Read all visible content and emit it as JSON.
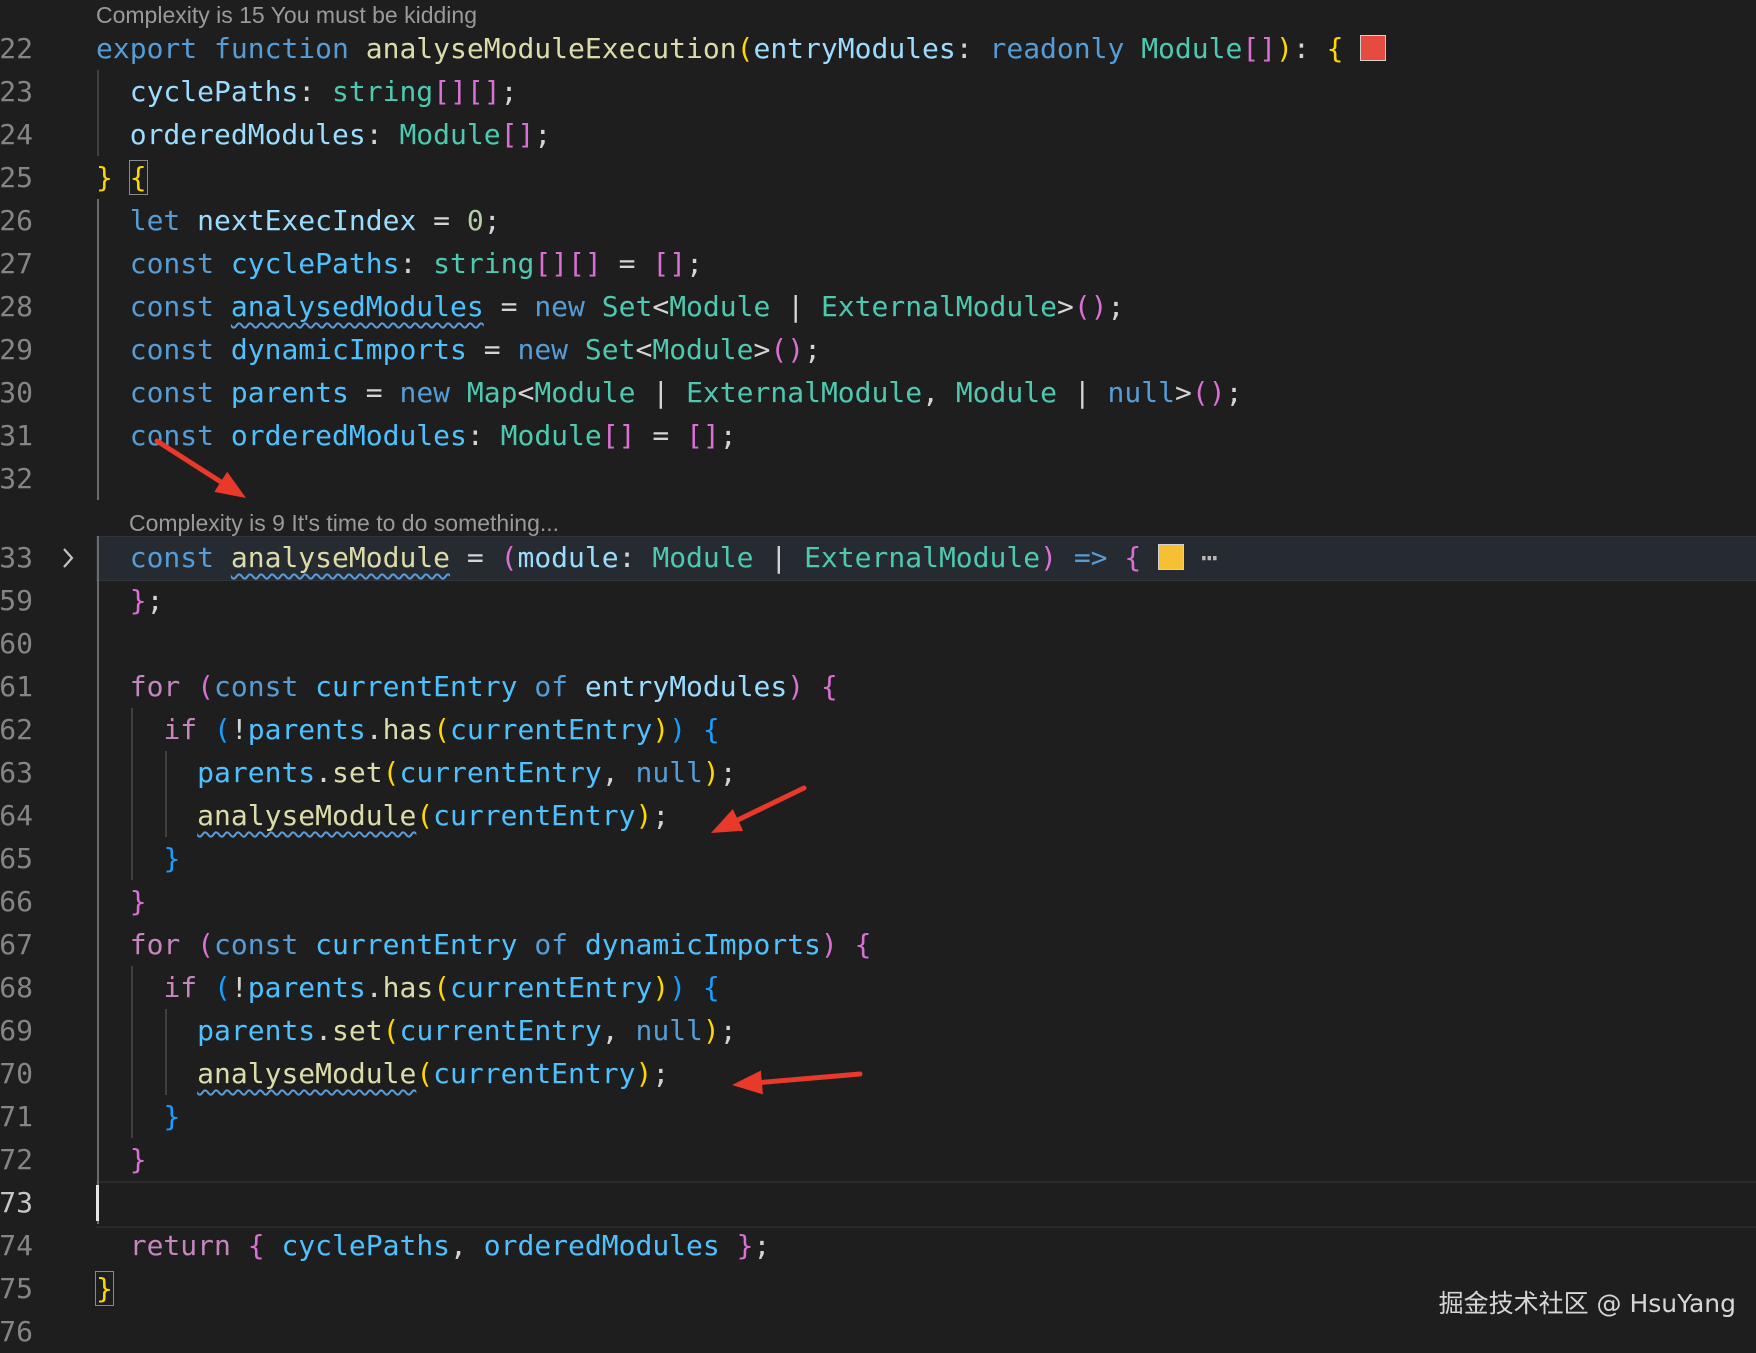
{
  "editor": {
    "codelens": [
      {
        "text": "Complexity is 15 You must be kidding"
      },
      {
        "text": "Complexity is 9 It's time to do something..."
      }
    ],
    "lines": [
      {
        "num": "22",
        "tokens": [
          [
            "export",
            "kw"
          ],
          [
            " ",
            "pn"
          ],
          [
            "function",
            "kw"
          ],
          [
            " ",
            "pn"
          ],
          [
            "analyseModuleExecution",
            "fn"
          ],
          [
            "(",
            "b1"
          ],
          [
            "entryModules",
            "vr"
          ],
          [
            ":",
            "pn"
          ],
          [
            " ",
            "pn"
          ],
          [
            "readonly",
            "kw"
          ],
          [
            " ",
            "pn"
          ],
          [
            "Module",
            "ty"
          ],
          [
            "[]",
            "b2"
          ],
          [
            ")",
            "b1"
          ],
          [
            ":",
            "pn"
          ],
          [
            " ",
            "pn"
          ],
          [
            "{",
            "b1"
          ],
          [
            " ",
            "pn"
          ],
          [
            "",
            "swatch-red"
          ]
        ]
      },
      {
        "num": "23",
        "tokens": [
          [
            "  ",
            "pn"
          ],
          [
            "cyclePaths",
            "vr"
          ],
          [
            ":",
            "pn"
          ],
          [
            " ",
            "pn"
          ],
          [
            "string",
            "ty"
          ],
          [
            "[]",
            "b2"
          ],
          [
            "[]",
            "b2"
          ],
          [
            ";",
            "pn"
          ]
        ]
      },
      {
        "num": "24",
        "tokens": [
          [
            "  ",
            "pn"
          ],
          [
            "orderedModules",
            "vr"
          ],
          [
            ":",
            "pn"
          ],
          [
            " ",
            "pn"
          ],
          [
            "Module",
            "ty"
          ],
          [
            "[]",
            "b2"
          ],
          [
            ";",
            "pn"
          ]
        ]
      },
      {
        "num": "25",
        "tokens": [
          [
            "}",
            "b1"
          ],
          [
            " ",
            "pn"
          ],
          [
            "{",
            "b1 bm"
          ]
        ]
      },
      {
        "num": "26",
        "tokens": [
          [
            "  ",
            "pn"
          ],
          [
            "let",
            "kw"
          ],
          [
            " ",
            "pn"
          ],
          [
            "nextExecIndex",
            "vr"
          ],
          [
            " = ",
            "pn"
          ],
          [
            "0",
            "nm"
          ],
          [
            ";",
            "pn"
          ]
        ]
      },
      {
        "num": "27",
        "tokens": [
          [
            "  ",
            "pn"
          ],
          [
            "const",
            "kw"
          ],
          [
            " ",
            "pn"
          ],
          [
            "cyclePaths",
            "cn"
          ],
          [
            ":",
            "pn"
          ],
          [
            " ",
            "pn"
          ],
          [
            "string",
            "ty"
          ],
          [
            "[]",
            "b2"
          ],
          [
            "[]",
            "b2"
          ],
          [
            " = ",
            "pn"
          ],
          [
            "[]",
            "b2"
          ],
          [
            ";",
            "pn"
          ]
        ]
      },
      {
        "num": "28",
        "tokens": [
          [
            "  ",
            "pn"
          ],
          [
            "const",
            "kw"
          ],
          [
            " ",
            "pn"
          ],
          [
            "analysedModules",
            "cn sq"
          ],
          [
            " = ",
            "pn"
          ],
          [
            "new",
            "kw"
          ],
          [
            " ",
            "pn"
          ],
          [
            "Set",
            "ty"
          ],
          [
            "<",
            "pn"
          ],
          [
            "Module",
            "ty"
          ],
          [
            " | ",
            "pn"
          ],
          [
            "ExternalModule",
            "ty"
          ],
          [
            ">",
            "pn"
          ],
          [
            "()",
            "b2"
          ],
          [
            ";",
            "pn"
          ]
        ]
      },
      {
        "num": "29",
        "tokens": [
          [
            "  ",
            "pn"
          ],
          [
            "const",
            "kw"
          ],
          [
            " ",
            "pn"
          ],
          [
            "dynamicImports",
            "cn"
          ],
          [
            " = ",
            "pn"
          ],
          [
            "new",
            "kw"
          ],
          [
            " ",
            "pn"
          ],
          [
            "Set",
            "ty"
          ],
          [
            "<",
            "pn"
          ],
          [
            "Module",
            "ty"
          ],
          [
            ">",
            "pn"
          ],
          [
            "()",
            "b2"
          ],
          [
            ";",
            "pn"
          ]
        ]
      },
      {
        "num": "30",
        "tokens": [
          [
            "  ",
            "pn"
          ],
          [
            "const",
            "kw"
          ],
          [
            " ",
            "pn"
          ],
          [
            "parents",
            "cn"
          ],
          [
            " = ",
            "pn"
          ],
          [
            "new",
            "kw"
          ],
          [
            " ",
            "pn"
          ],
          [
            "Map",
            "ty"
          ],
          [
            "<",
            "pn"
          ],
          [
            "Module",
            "ty"
          ],
          [
            " | ",
            "pn"
          ],
          [
            "ExternalModule",
            "ty"
          ],
          [
            ", ",
            "pn"
          ],
          [
            "Module",
            "ty"
          ],
          [
            " | ",
            "pn"
          ],
          [
            "null",
            "kw"
          ],
          [
            ">",
            "pn"
          ],
          [
            "()",
            "b2"
          ],
          [
            ";",
            "pn"
          ]
        ]
      },
      {
        "num": "31",
        "tokens": [
          [
            "  ",
            "pn"
          ],
          [
            "const",
            "kw"
          ],
          [
            " ",
            "pn"
          ],
          [
            "orderedModules",
            "cn"
          ],
          [
            ":",
            "pn"
          ],
          [
            " ",
            "pn"
          ],
          [
            "Module",
            "ty"
          ],
          [
            "[]",
            "b2"
          ],
          [
            " = ",
            "pn"
          ],
          [
            "[]",
            "b2"
          ],
          [
            ";",
            "pn"
          ]
        ]
      },
      {
        "num": "32",
        "tokens": []
      },
      {
        "num": "33",
        "tokens": [
          [
            "  ",
            "pn"
          ],
          [
            "const",
            "kw"
          ],
          [
            " ",
            "pn"
          ],
          [
            "analyseModule",
            "fn sq"
          ],
          [
            " = ",
            "pn"
          ],
          [
            "(",
            "b2"
          ],
          [
            "module",
            "vr"
          ],
          [
            ":",
            "pn"
          ],
          [
            " ",
            "pn"
          ],
          [
            "Module",
            "ty"
          ],
          [
            " | ",
            "pn"
          ],
          [
            "ExternalModule",
            "ty"
          ],
          [
            ")",
            "b2"
          ],
          [
            " ",
            "pn"
          ],
          [
            "=>",
            "kw"
          ],
          [
            " ",
            "pn"
          ],
          [
            "{",
            "b2"
          ],
          [
            " ",
            "pn"
          ],
          [
            "",
            "swatch-yellow"
          ],
          [
            " ",
            "pn"
          ],
          [
            "⋯",
            "ellipsis"
          ]
        ]
      },
      {
        "num": "59",
        "tokens": [
          [
            "  ",
            "pn"
          ],
          [
            "}",
            "b2"
          ],
          [
            ";",
            "pn"
          ]
        ]
      },
      {
        "num": "60",
        "tokens": []
      },
      {
        "num": "61",
        "tokens": [
          [
            "  ",
            "pn"
          ],
          [
            "for",
            "kw2"
          ],
          [
            " ",
            "pn"
          ],
          [
            "(",
            "b2"
          ],
          [
            "const",
            "kw"
          ],
          [
            " ",
            "pn"
          ],
          [
            "currentEntry",
            "cn"
          ],
          [
            " ",
            "pn"
          ],
          [
            "of",
            "kw"
          ],
          [
            " ",
            "pn"
          ],
          [
            "entryModules",
            "vr"
          ],
          [
            ")",
            "b2"
          ],
          [
            " ",
            "pn"
          ],
          [
            "{",
            "b2"
          ]
        ]
      },
      {
        "num": "62",
        "tokens": [
          [
            "    ",
            "pn"
          ],
          [
            "if",
            "kw2"
          ],
          [
            " ",
            "pn"
          ],
          [
            "(",
            "b3"
          ],
          [
            "!",
            "pn"
          ],
          [
            "parents",
            "cn"
          ],
          [
            ".",
            "pn"
          ],
          [
            "has",
            "fn"
          ],
          [
            "(",
            "b1"
          ],
          [
            "currentEntry",
            "cn"
          ],
          [
            ")",
            "b1"
          ],
          [
            ")",
            "b3"
          ],
          [
            " ",
            "pn"
          ],
          [
            "{",
            "b3"
          ]
        ]
      },
      {
        "num": "63",
        "tokens": [
          [
            "      ",
            "pn"
          ],
          [
            "parents",
            "cn"
          ],
          [
            ".",
            "pn"
          ],
          [
            "set",
            "fn"
          ],
          [
            "(",
            "b1"
          ],
          [
            "currentEntry",
            "cn"
          ],
          [
            ", ",
            "pn"
          ],
          [
            "null",
            "kw"
          ],
          [
            ")",
            "b1"
          ],
          [
            ";",
            "pn"
          ]
        ]
      },
      {
        "num": "64",
        "tokens": [
          [
            "      ",
            "pn"
          ],
          [
            "analyseModule",
            "fn sq"
          ],
          [
            "(",
            "b1"
          ],
          [
            "currentEntry",
            "cn"
          ],
          [
            ")",
            "b1"
          ],
          [
            ";",
            "pn"
          ]
        ]
      },
      {
        "num": "65",
        "tokens": [
          [
            "    ",
            "pn"
          ],
          [
            "}",
            "b3"
          ]
        ]
      },
      {
        "num": "66",
        "tokens": [
          [
            "  ",
            "pn"
          ],
          [
            "}",
            "b2"
          ]
        ]
      },
      {
        "num": "67",
        "tokens": [
          [
            "  ",
            "pn"
          ],
          [
            "for",
            "kw2"
          ],
          [
            " ",
            "pn"
          ],
          [
            "(",
            "b2"
          ],
          [
            "const",
            "kw"
          ],
          [
            " ",
            "pn"
          ],
          [
            "currentEntry",
            "cn"
          ],
          [
            " ",
            "pn"
          ],
          [
            "of",
            "kw"
          ],
          [
            " ",
            "pn"
          ],
          [
            "dynamicImports",
            "cn"
          ],
          [
            ")",
            "b2"
          ],
          [
            " ",
            "pn"
          ],
          [
            "{",
            "b2"
          ]
        ]
      },
      {
        "num": "68",
        "tokens": [
          [
            "    ",
            "pn"
          ],
          [
            "if",
            "kw2"
          ],
          [
            " ",
            "pn"
          ],
          [
            "(",
            "b3"
          ],
          [
            "!",
            "pn"
          ],
          [
            "parents",
            "cn"
          ],
          [
            ".",
            "pn"
          ],
          [
            "has",
            "fn"
          ],
          [
            "(",
            "b1"
          ],
          [
            "currentEntry",
            "cn"
          ],
          [
            ")",
            "b1"
          ],
          [
            ")",
            "b3"
          ],
          [
            " ",
            "pn"
          ],
          [
            "{",
            "b3"
          ]
        ]
      },
      {
        "num": "69",
        "tokens": [
          [
            "      ",
            "pn"
          ],
          [
            "parents",
            "cn"
          ],
          [
            ".",
            "pn"
          ],
          [
            "set",
            "fn"
          ],
          [
            "(",
            "b1"
          ],
          [
            "currentEntry",
            "cn"
          ],
          [
            ", ",
            "pn"
          ],
          [
            "null",
            "kw"
          ],
          [
            ")",
            "b1"
          ],
          [
            ";",
            "pn"
          ]
        ]
      },
      {
        "num": "70",
        "tokens": [
          [
            "      ",
            "pn"
          ],
          [
            "analyseModule",
            "fn sq"
          ],
          [
            "(",
            "b1"
          ],
          [
            "currentEntry",
            "cn"
          ],
          [
            ")",
            "b1"
          ],
          [
            ";",
            "pn"
          ]
        ]
      },
      {
        "num": "71",
        "tokens": [
          [
            "    ",
            "pn"
          ],
          [
            "}",
            "b3"
          ]
        ]
      },
      {
        "num": "72",
        "tokens": [
          [
            "  ",
            "pn"
          ],
          [
            "}",
            "b2"
          ]
        ]
      },
      {
        "num": "73",
        "tokens": [],
        "active": true
      },
      {
        "num": "74",
        "tokens": [
          [
            "  ",
            "pn"
          ],
          [
            "return",
            "kw2"
          ],
          [
            " ",
            "pn"
          ],
          [
            "{",
            "b2"
          ],
          [
            " ",
            "pn"
          ],
          [
            "cyclePaths",
            "cn"
          ],
          [
            ", ",
            "pn"
          ],
          [
            "orderedModules",
            "cn"
          ],
          [
            " ",
            "pn"
          ],
          [
            "}",
            "b2"
          ],
          [
            ";",
            "pn"
          ]
        ]
      },
      {
        "num": "75",
        "tokens": [
          [
            "}",
            "b1 bm"
          ]
        ]
      },
      {
        "num": "76",
        "tokens": []
      }
    ]
  },
  "watermark": {
    "text": "掘金技术社区 @ HsuYang"
  },
  "colors": {
    "annotation_arrow": "#e8392b",
    "background": "#1e1e1e"
  }
}
